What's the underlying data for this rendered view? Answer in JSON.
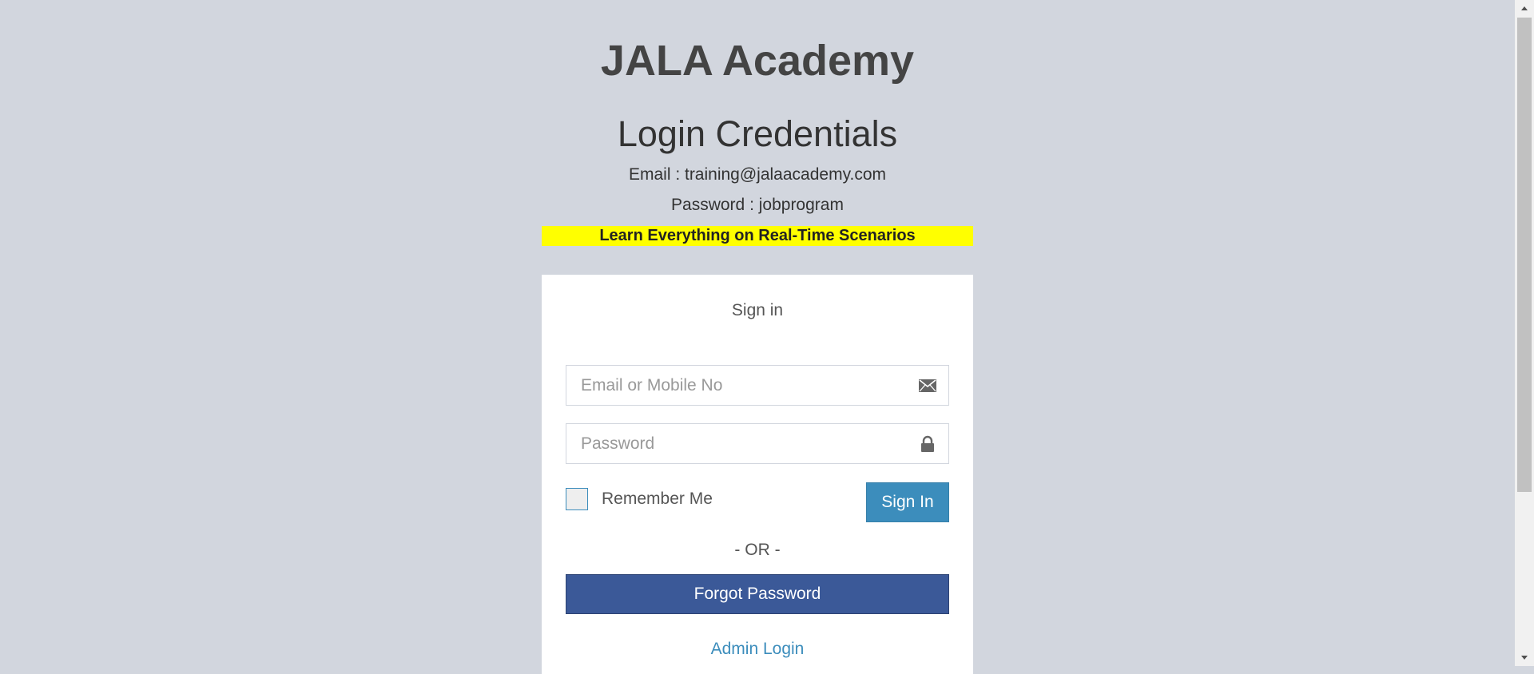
{
  "header": {
    "brand": "JALA Academy",
    "credentials_title": "Login Credentials",
    "email_line": "Email : training@jalaacademy.com",
    "password_line": "Password : jobprogram",
    "banner": "Learn Everything on Real-Time Scenarios"
  },
  "login": {
    "heading": "Sign in",
    "email_placeholder": "Email or Mobile No",
    "email_value": "",
    "email_icon": "envelope-icon",
    "password_placeholder": "Password",
    "password_value": "",
    "password_icon": "lock-icon",
    "remember_label": "Remember Me",
    "remember_checked": false,
    "signin_label": "Sign In",
    "or_text": "- OR -",
    "forgot_label": "Forgot Password",
    "admin_label": "Admin Login"
  },
  "colors": {
    "background": "#d2d6de",
    "banner": "#ffff00",
    "primary_button": "#3c8dbc",
    "forgot_button": "#3b5998",
    "link": "#3c8dbc"
  }
}
